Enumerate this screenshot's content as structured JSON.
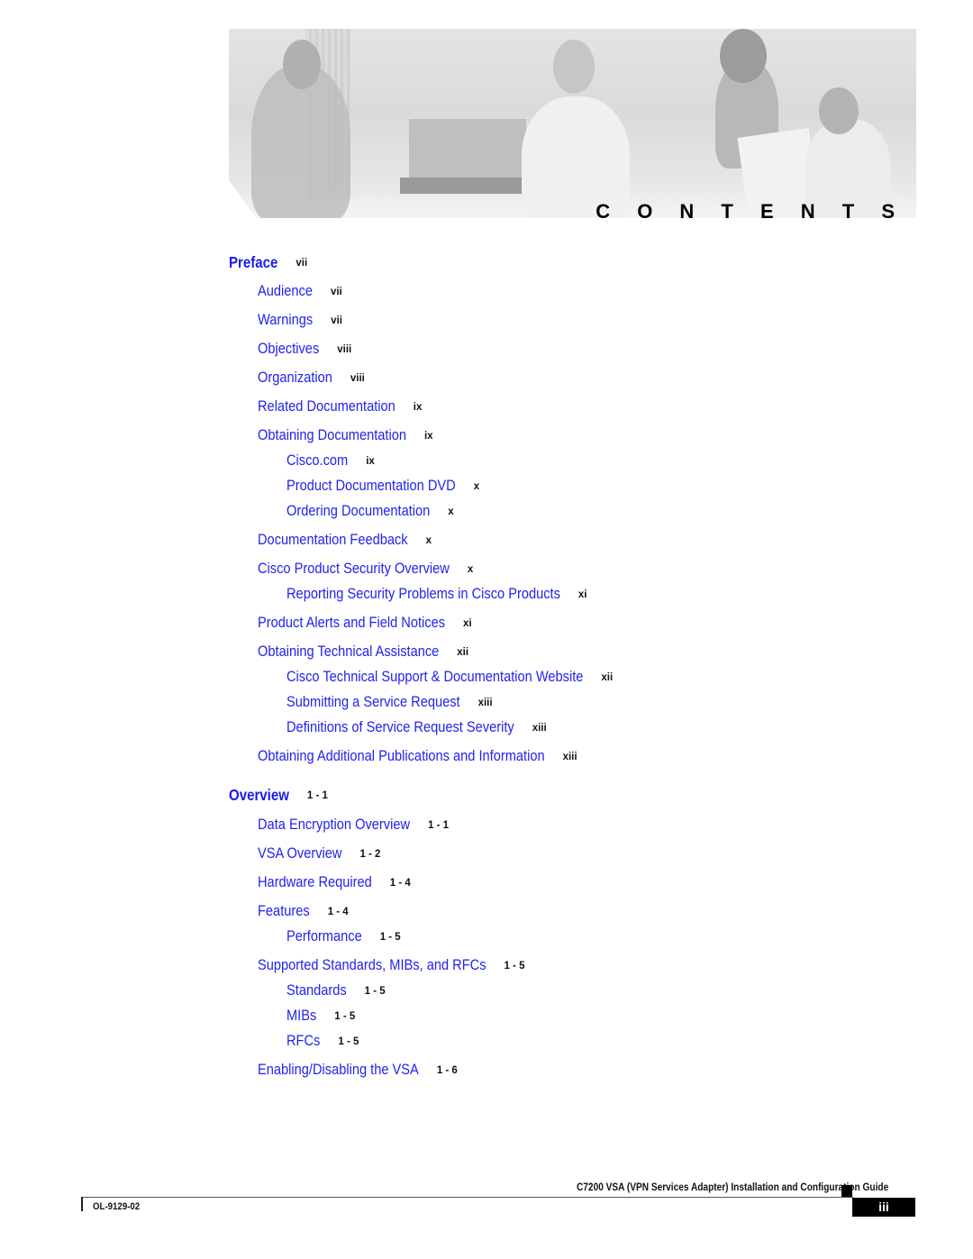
{
  "header": {
    "banner_image": "photo-of-four-people-working-with-laptop-and-documents",
    "title": "C O N T E N T S"
  },
  "toc": [
    {
      "title": "Preface",
      "page": "vii",
      "level": 0
    },
    {
      "title": "Audience",
      "page": "vii",
      "level": 1
    },
    {
      "title": "Warnings",
      "page": "vii",
      "level": 1
    },
    {
      "title": "Objectives",
      "page": "viii",
      "level": 1
    },
    {
      "title": "Organization",
      "page": "viii",
      "level": 1
    },
    {
      "title": "Related Documentation",
      "page": "ix",
      "level": 1
    },
    {
      "title": "Obtaining Documentation",
      "page": "ix",
      "level": 1
    },
    {
      "title": "Cisco.com",
      "page": "ix",
      "level": 2
    },
    {
      "title": "Product Documentation DVD",
      "page": "x",
      "level": 2
    },
    {
      "title": "Ordering Documentation",
      "page": "x",
      "level": 2
    },
    {
      "title": "Documentation Feedback",
      "page": "x",
      "level": 1
    },
    {
      "title": "Cisco Product Security Overview",
      "page": "x",
      "level": 1
    },
    {
      "title": "Reporting Security Problems in Cisco Products",
      "page": "xi",
      "level": 2
    },
    {
      "title": "Product Alerts and Field Notices",
      "page": "xi",
      "level": 1
    },
    {
      "title": "Obtaining Technical Assistance",
      "page": "xii",
      "level": 1
    },
    {
      "title": "Cisco Technical Support & Documentation Website",
      "page": "xii",
      "level": 2
    },
    {
      "title": "Submitting a Service Request",
      "page": "xiii",
      "level": 2
    },
    {
      "title": "Definitions of Service Request Severity",
      "page": "xiii",
      "level": 2
    },
    {
      "title": "Obtaining Additional Publications and Information",
      "page": "xiii",
      "level": 1
    },
    {
      "title": "Overview",
      "page": "1 - 1",
      "level": 0
    },
    {
      "title": "Data Encryption Overview",
      "page": "1 - 1",
      "level": 1
    },
    {
      "title": "VSA Overview",
      "page": "1 - 2",
      "level": 1
    },
    {
      "title": "Hardware Required",
      "page": "1 - 4",
      "level": 1
    },
    {
      "title": "Features",
      "page": "1 - 4",
      "level": 1
    },
    {
      "title": "Performance",
      "page": "1 - 5",
      "level": 2
    },
    {
      "title": "Supported Standards, MIBs, and RFCs",
      "page": "1 - 5",
      "level": 1
    },
    {
      "title": "Standards",
      "page": "1 - 5",
      "level": 2
    },
    {
      "title": "MIBs",
      "page": "1 - 5",
      "level": 2
    },
    {
      "title": "RFCs",
      "page": "1 - 5",
      "level": 2
    },
    {
      "title": "Enabling/Disabling the VSA",
      "page": "1 - 6",
      "level": 1
    }
  ],
  "footer": {
    "guide_title": "C7200 VSA (VPN Services Adapter) Installation and Configuration Guide",
    "doc_number": "OL-9129-02",
    "page_number": "iii"
  },
  "colors": {
    "link": "#2222ee",
    "page_number": "#111111"
  }
}
